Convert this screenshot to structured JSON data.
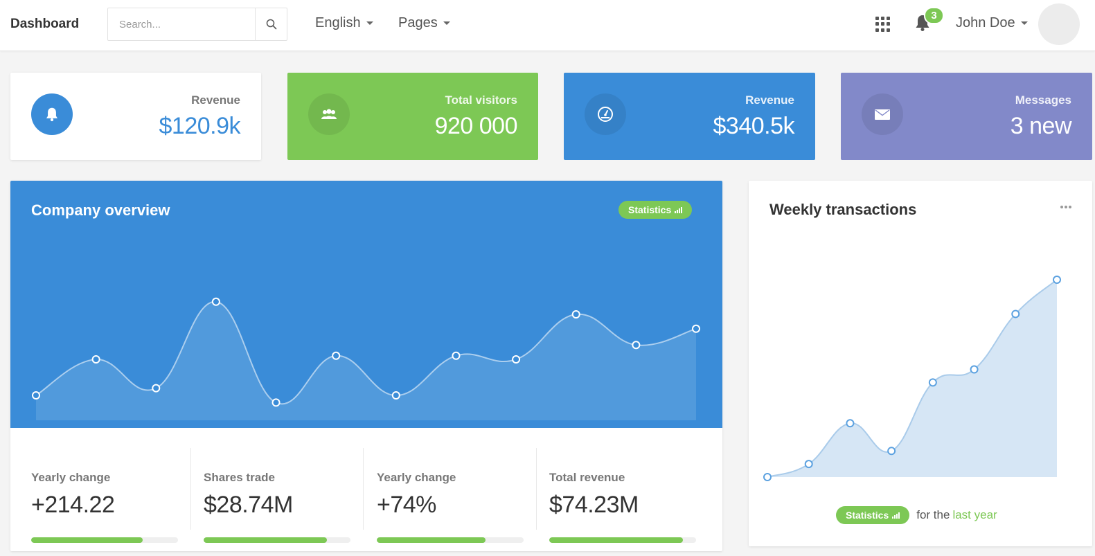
{
  "topnav": {
    "brand": "Dashboard",
    "search_placeholder": "Search...",
    "language": "English",
    "pages": "Pages",
    "notifications_count": "3",
    "user_name": "John Doe"
  },
  "cards": [
    {
      "label": "Revenue",
      "value": "$120.9k",
      "icon": "bell-icon"
    },
    {
      "label": "Total visitors",
      "value": "920 000",
      "icon": "users-icon"
    },
    {
      "label": "Revenue",
      "value": "$340.5k",
      "icon": "dashboard-gauge-icon"
    },
    {
      "label": "Messages",
      "value": "3 new",
      "icon": "envelope-icon"
    }
  ],
  "overview": {
    "title": "Company overview",
    "badge": "Statistics",
    "stats": [
      {
        "label": "Yearly change",
        "value": "+214.22",
        "progress": 0.76
      },
      {
        "label": "Shares trade",
        "value": "$28.74M",
        "progress": 0.84
      },
      {
        "label": "Yearly change",
        "value": "+74%",
        "progress": 0.74
      },
      {
        "label": "Total revenue",
        "value": "$74.23M",
        "progress": 0.91
      }
    ]
  },
  "weekly": {
    "title": "Weekly transactions",
    "badge": "Statistics",
    "footer_text": "for the",
    "footer_link": "last year"
  },
  "colors": {
    "blue": "#3a8cd8",
    "green": "#7dc855",
    "purple": "#8289c9",
    "light_blue_fill": "#d6e6f5"
  },
  "chart_data": [
    {
      "type": "area",
      "x": [
        1,
        2,
        3,
        4,
        5,
        6,
        7,
        8,
        9,
        10,
        11,
        12
      ],
      "series": [
        {
          "values": [
            10,
            30,
            14,
            62,
            6,
            32,
            10,
            32,
            30,
            55,
            38,
            47
          ]
        }
      ],
      "ylim": [
        0,
        100
      ],
      "grid": false
    },
    {
      "type": "area",
      "x": [
        1,
        2,
        3,
        4,
        5,
        6,
        7,
        8
      ],
      "series": [
        {
          "values": [
            0,
            8,
            33,
            16,
            58,
            66,
            100,
            121
          ]
        }
      ],
      "ylim": [
        0,
        135
      ],
      "grid": false
    }
  ]
}
